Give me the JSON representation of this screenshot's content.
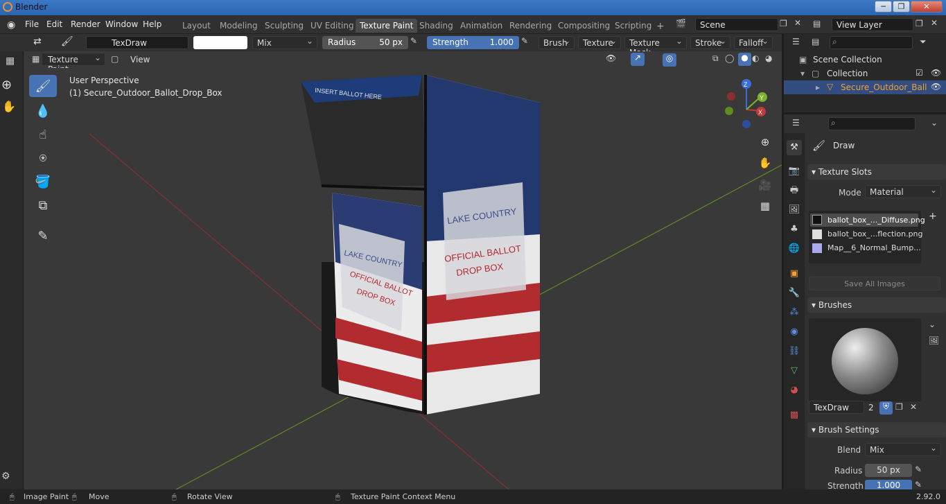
{
  "window": {
    "title": "Blender",
    "min": "─",
    "max": "❐",
    "close": "✕"
  },
  "menu": [
    "File",
    "Edit",
    "Render",
    "Window",
    "Help"
  ],
  "workspaces": [
    {
      "label": "Layout",
      "active": false
    },
    {
      "label": "Modeling",
      "active": false
    },
    {
      "label": "Sculpting",
      "active": false
    },
    {
      "label": "UV Editing",
      "active": false
    },
    {
      "label": "Texture Paint",
      "active": true
    },
    {
      "label": "Shading",
      "active": false
    },
    {
      "label": "Animation",
      "active": false
    },
    {
      "label": "Rendering",
      "active": false
    },
    {
      "label": "Compositing",
      "active": false
    },
    {
      "label": "Scripting",
      "active": false
    }
  ],
  "add_tab": "+",
  "scene": "Scene",
  "view_layer": "View Layer",
  "tool_header": {
    "brush_name": "TexDraw",
    "blend": "Mix",
    "radius_label": "Radius",
    "radius_value": "50 px",
    "strength_label": "Strength",
    "strength_value": "1.000",
    "brush_menu": "Brush",
    "texture_menu": "Texture",
    "texture_mask_menu": "Texture Mask",
    "stroke_menu": "Stroke",
    "falloff_menu": "Falloff"
  },
  "view_header": {
    "mode": "Texture Paint",
    "view": "View"
  },
  "viewport": {
    "perspective": "User Perspective",
    "object": "(1) Secure_Outdoor_Ballot_Drop_Box",
    "box_top_text": "INSERT BALLOT HERE",
    "box_front_lines": [
      "LAKE COUNTRY",
      "OFFICIAL BALLOT",
      "DROP BOX"
    ]
  },
  "gizmo": {
    "x": "X",
    "y": "Y",
    "z": "Z"
  },
  "outliner": {
    "scene_collection": "Scene Collection",
    "collection": "Collection",
    "object": "Secure_Outdoor_Ball"
  },
  "properties": {
    "tool_name": "Draw",
    "texture_slots": {
      "title": "Texture Slots",
      "mode_label": "Mode",
      "mode_value": "Material",
      "items": [
        "ballot_box_..._Diffuse.png",
        "ballot_box_...flection.png",
        "Map__6_Normal_Bump..."
      ],
      "save_all": "Save All Images"
    },
    "brushes": {
      "title": "Brushes",
      "brush_name": "TexDraw",
      "users": "2"
    },
    "brush_settings": {
      "title": "Brush Settings",
      "blend_label": "Blend",
      "blend_value": "Mix",
      "radius_label": "Radius",
      "radius_value": "50 px",
      "strength_label": "Strength",
      "strength_value": "1.000"
    }
  },
  "status": {
    "image_paint": "Image Paint",
    "move": "Move",
    "rotate": "Rotate View",
    "context": "Texture Paint Context Menu",
    "version": "2.92.0"
  },
  "colors": {
    "accent": "#4772b3",
    "active_object": "#f0a030",
    "viewport_bg": "#393939",
    "x_axis": "#c0393b",
    "y_axis": "#7fb32d"
  }
}
